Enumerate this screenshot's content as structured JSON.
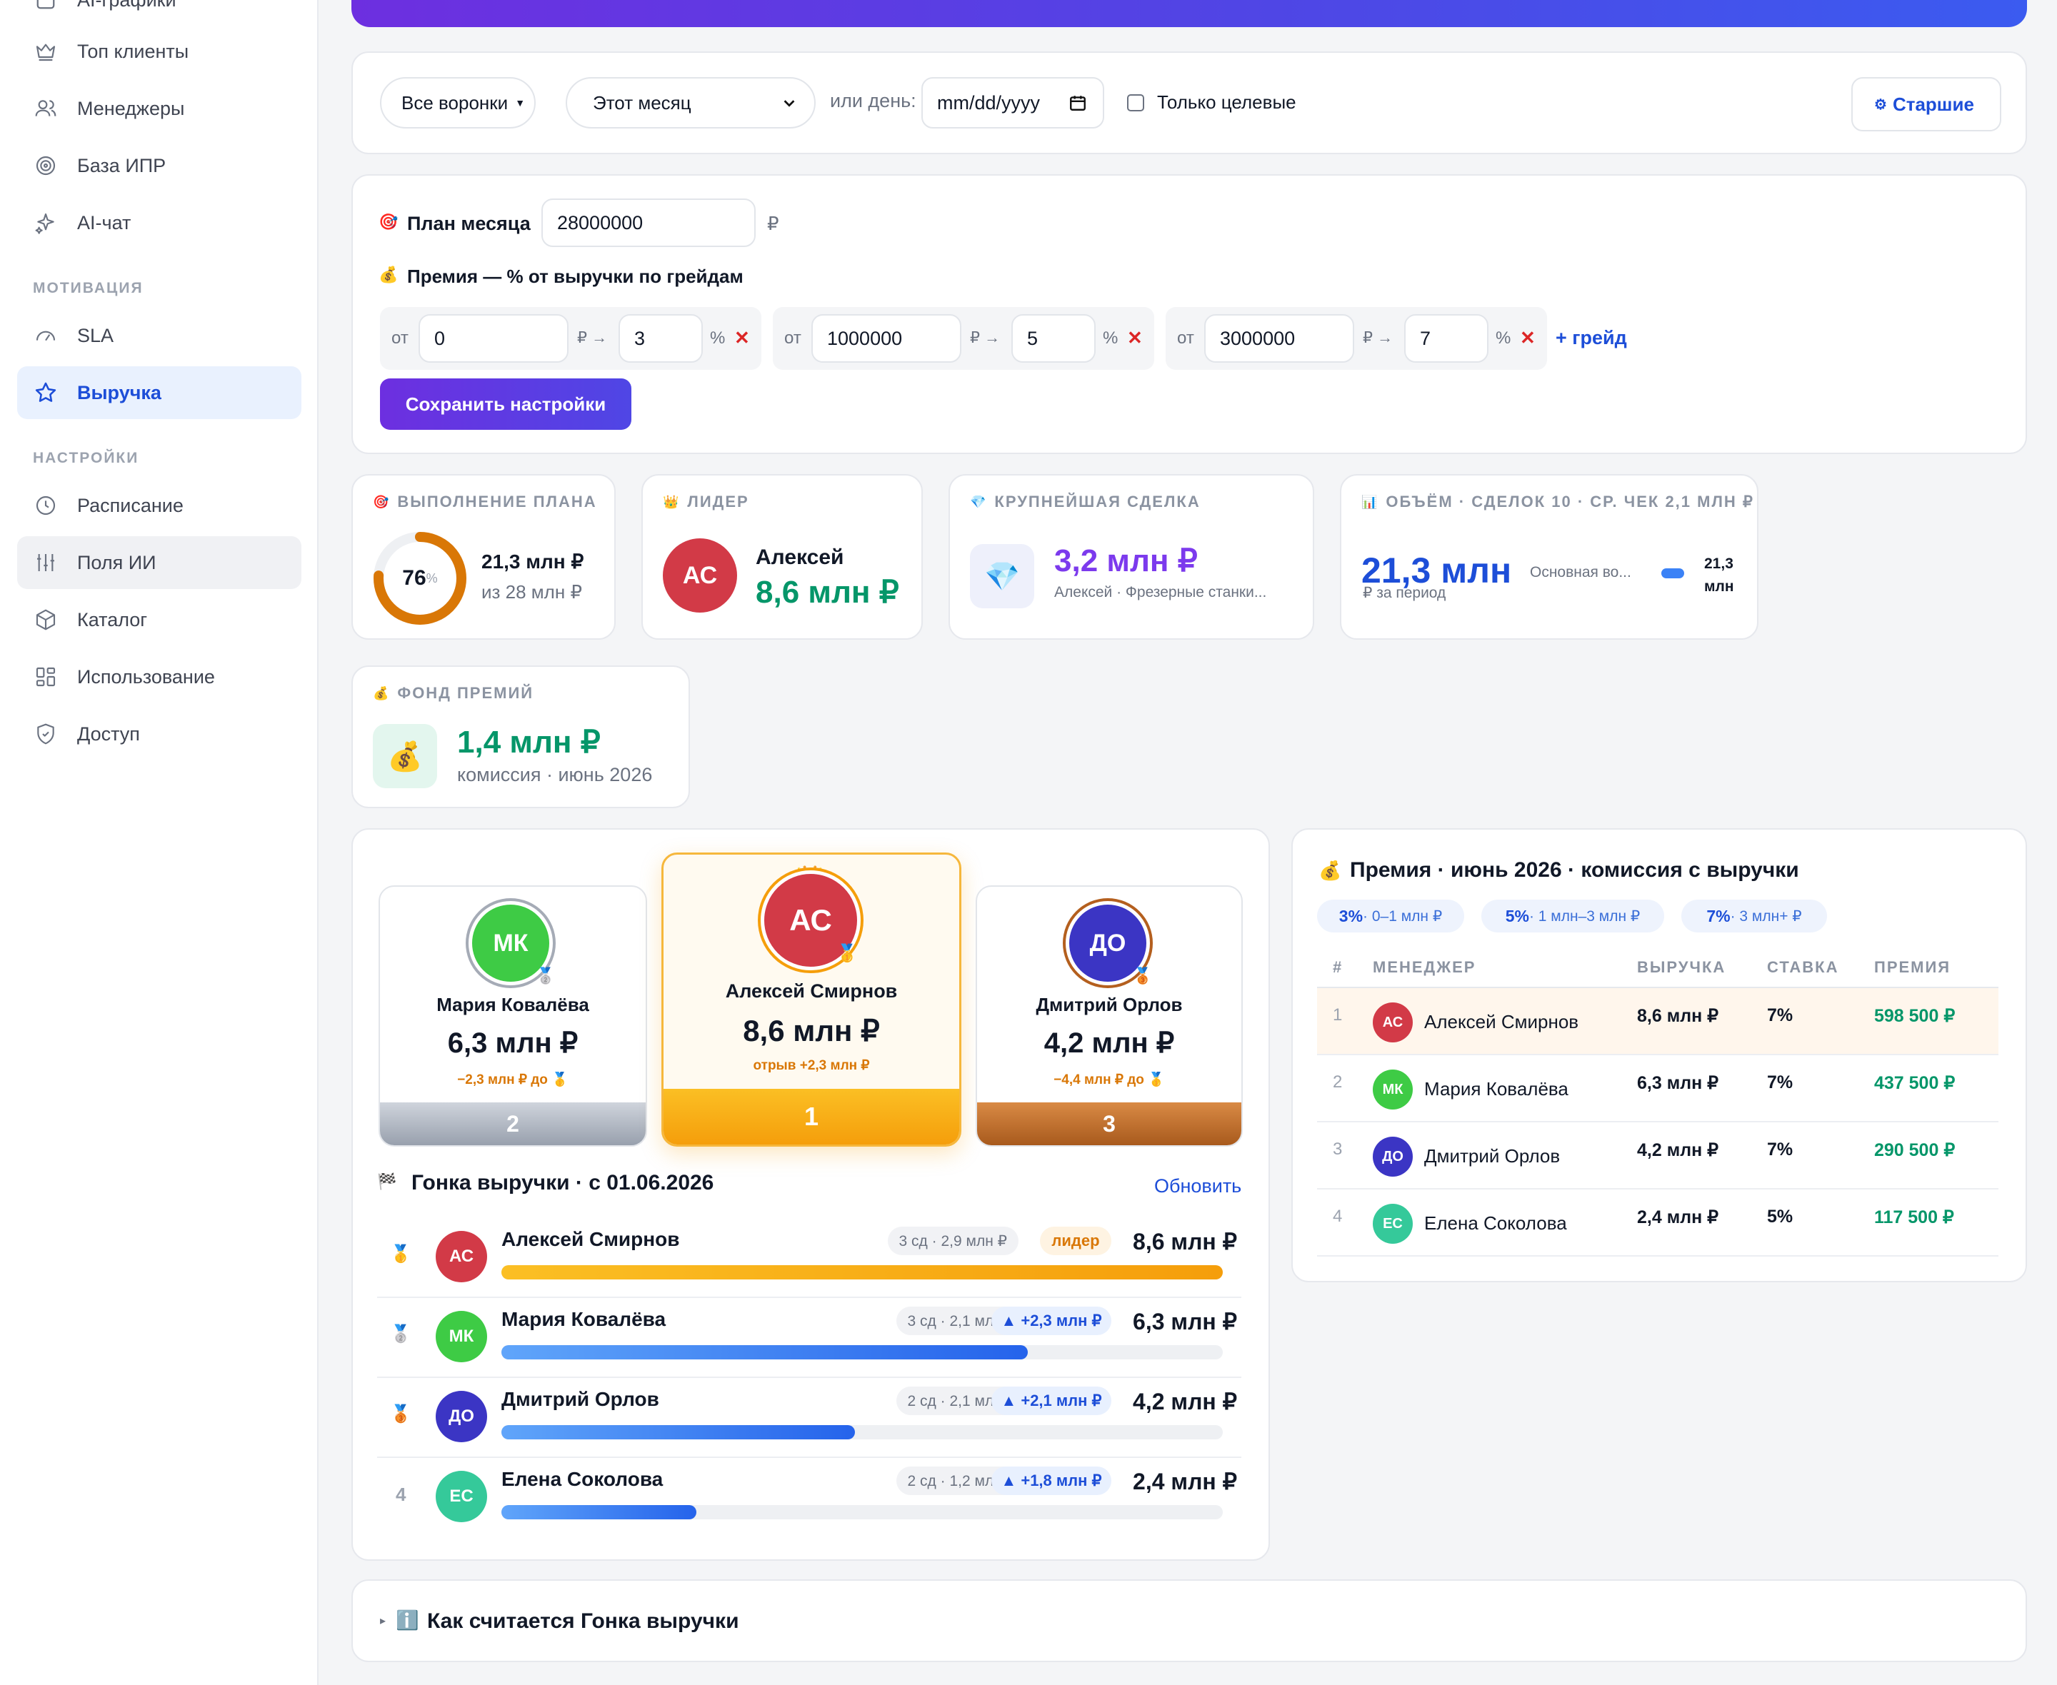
{
  "sidebar": {
    "partial_top": "AI-графики",
    "items_top": [
      {
        "label": "Топ клиенты",
        "icon": "crown-icon"
      },
      {
        "label": "Менеджеры",
        "icon": "users-icon"
      },
      {
        "label": "База ИПР",
        "icon": "target-icon"
      },
      {
        "label": "AI-чат",
        "icon": "sparkle-icon"
      }
    ],
    "section_motivation": "МОТИВАЦИЯ",
    "items_motivation": [
      {
        "label": "SLA",
        "icon": "gauge-icon"
      },
      {
        "label": "Выручка",
        "icon": "star-icon"
      }
    ],
    "section_settings": "НАСТРОЙКИ",
    "items_settings": [
      {
        "label": "Расписание",
        "icon": "clock-icon"
      },
      {
        "label": "Поля ИИ",
        "icon": "sliders-icon"
      },
      {
        "label": "Каталог",
        "icon": "box-icon"
      },
      {
        "label": "Использование",
        "icon": "grid-icon"
      },
      {
        "label": "Доступ",
        "icon": "shield-icon"
      }
    ]
  },
  "filters": {
    "funnels": "Все воронки",
    "period": "Этот месяц",
    "or_day": "или день:",
    "date_placeholder": "mm/dd/yyyy",
    "only_target": "Только целевые",
    "seniors_button": "Старшие"
  },
  "plan": {
    "plan_label": "План месяца",
    "plan_value": "28000000",
    "currency": "₽",
    "bonus_label": "Премия — % от выручки по грейдам",
    "from": "от",
    "arrow": "₽ →",
    "percent": "%",
    "grades": [
      {
        "from": "0",
        "rate": "3"
      },
      {
        "from": "1000000",
        "rate": "5"
      },
      {
        "from": "3000000",
        "rate": "7"
      }
    ],
    "add_grade": "+ грейд",
    "save": "Сохранить настройки"
  },
  "kpi": {
    "plan_label": "ВЫПОЛНЕНИЕ ПЛАНА",
    "plan_percent": "76",
    "plan_percent_value": 0.76,
    "plan_percent_sign": "%",
    "plan_done": "21,3 млн ₽",
    "plan_of": "из 28 млн ₽",
    "leader_label": "ЛИДЕР",
    "leader_initials": "АС",
    "leader_name": "Алексей",
    "leader_value": "8,6 млн ₽",
    "deal_label": "КРУПНЕЙШАЯ СДЕЛКА",
    "deal_value": "3,2 млн ₽",
    "deal_sub": "Алексей · Фрезерные станки...",
    "volume_label": "ОБЪЁМ · СДЕЛОК 10 · СР. ЧЕК 2,1 МЛН ₽",
    "volume_value": "21,3 млн",
    "volume_sub": "₽ за период",
    "volume_funnel": "Основная во...",
    "volume_funnel_val1": "21,3",
    "volume_funnel_val2": "млн",
    "fund_label": "ФОНД ПРЕМИЙ",
    "fund_value": "1,4 млн ₽",
    "fund_sub": "комиссия · июнь 2026"
  },
  "podium": [
    {
      "place": "2",
      "initials": "МК",
      "name": "Мария Ковалёва",
      "value": "6,3 млн ₽",
      "note": "−2,3 млн ₽ до 🥇"
    },
    {
      "place": "1",
      "initials": "АС",
      "name": "Алексей Смирнов",
      "value": "8,6 млн ₽",
      "note": "отрыв +2,3 млн ₽"
    },
    {
      "place": "3",
      "initials": "ДО",
      "name": "Дмитрий Орлов",
      "value": "4,2 млн ₽",
      "note": "−4,4 млн ₽ до 🥇"
    }
  ],
  "race": {
    "title": "Гонка выручки · с 01.06.2026",
    "refresh": "Обновить",
    "rows": [
      {
        "rank": "🥇",
        "initials": "АС",
        "name": "Алексей Смирнов",
        "deals": "3 сд · 2,9 млн ₽",
        "badge": "лидер",
        "value": "8,6 млн ₽",
        "share": 1.0
      },
      {
        "rank": "🥈",
        "initials": "МК",
        "name": "Мария Ковалёва",
        "deals": "3 сд · 2,1 млн ₽",
        "badge": "▲ +2,3 млн ₽",
        "value": "6,3 млн ₽",
        "share": 0.73
      },
      {
        "rank": "🥉",
        "initials": "ДО",
        "name": "Дмитрий Орлов",
        "deals": "2 сд · 2,1 млн ₽",
        "badge": "▲ +2,1 млн ₽",
        "value": "4,2 млн ₽",
        "share": 0.49
      },
      {
        "rank": "4",
        "initials": "ЕС",
        "name": "Елена Соколова",
        "deals": "2 сд · 1,2 млн ₽",
        "badge": "▲ +1,8 млн ₽",
        "value": "2,4 млн ₽",
        "share": 0.27
      }
    ]
  },
  "bonus": {
    "title": "Премия · июнь 2026 · комиссия с выручки",
    "tiers": [
      {
        "rate": "3%",
        "range": " · 0–1 млн ₽"
      },
      {
        "rate": "5%",
        "range": " · 1 млн–3 млн ₽"
      },
      {
        "rate": "7%",
        "range": " · 3 млн+ ₽"
      }
    ],
    "headers": {
      "num": "#",
      "manager": "МЕНЕДЖЕР",
      "revenue": "ВЫРУЧКА",
      "rate": "СТАВКА",
      "bonus": "ПРЕМИЯ"
    },
    "rows": [
      {
        "num": "1",
        "initials": "АС",
        "name": "Алексей Смирнов",
        "revenue": "8,6 млн ₽",
        "rate": "7%",
        "bonus": "598 500 ₽"
      },
      {
        "num": "2",
        "initials": "МК",
        "name": "Мария Ковалёва",
        "revenue": "6,3 млн ₽",
        "rate": "7%",
        "bonus": "437 500 ₽"
      },
      {
        "num": "3",
        "initials": "ДО",
        "name": "Дмитрий Орлов",
        "revenue": "4,2 млн ₽",
        "rate": "7%",
        "bonus": "290 500 ₽"
      },
      {
        "num": "4",
        "initials": "ЕС",
        "name": "Елена Соколова",
        "revenue": "2,4 млн ₽",
        "rate": "5%",
        "bonus": "117 500 ₽"
      }
    ]
  },
  "howto": {
    "title": "Как считается Гонка выручки"
  },
  "colors": {
    "accent": "#1d4ed8",
    "green": "#059669",
    "purple": "#7c3aed",
    "orange": "#d97706",
    "avatar_as": "#d23a47",
    "avatar_mk": "#3ecb45",
    "avatar_do": "#3b35c4",
    "avatar_ec": "#35c99a"
  }
}
